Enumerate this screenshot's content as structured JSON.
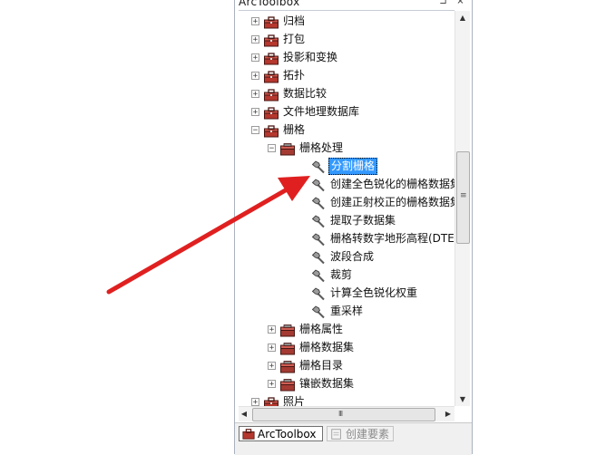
{
  "window": {
    "title": "ArcToolbox",
    "pin_glyph": "⊐",
    "close_glyph": "×"
  },
  "tree": [
    {
      "label": "归档",
      "expander": "+",
      "icon": "toolbox-icon"
    },
    {
      "label": "打包",
      "expander": "+",
      "icon": "toolbox-icon"
    },
    {
      "label": "投影和变换",
      "expander": "+",
      "icon": "toolbox-icon"
    },
    {
      "label": "拓扑",
      "expander": "+",
      "icon": "toolbox-icon"
    },
    {
      "label": "数据比较",
      "expander": "+",
      "icon": "toolbox-icon"
    },
    {
      "label": "文件地理数据库",
      "expander": "+",
      "icon": "toolbox-icon"
    },
    {
      "label": "栅格",
      "expander": "−",
      "icon": "toolbox-icon"
    },
    {
      "label": "栅格处理",
      "expander": "−",
      "icon": "toolset-icon"
    },
    {
      "label": "分割栅格",
      "icon": "hammer-icon",
      "selected": true
    },
    {
      "label": "创建全色锐化的栅格数据集",
      "icon": "hammer-icon"
    },
    {
      "label": "创建正射校正的栅格数据集",
      "icon": "hammer-icon"
    },
    {
      "label": "提取子数据集",
      "icon": "hammer-icon"
    },
    {
      "label": "栅格转数字地形高程(DTED)",
      "icon": "hammer-icon"
    },
    {
      "label": "波段合成",
      "icon": "hammer-icon"
    },
    {
      "label": "裁剪",
      "icon": "hammer-icon"
    },
    {
      "label": "计算全色锐化权重",
      "icon": "hammer-icon"
    },
    {
      "label": "重采样",
      "icon": "hammer-icon"
    },
    {
      "label": "栅格属性",
      "expander": "+",
      "icon": "toolset-icon"
    },
    {
      "label": "栅格数据集",
      "expander": "+",
      "icon": "toolset-icon"
    },
    {
      "label": "栅格目录",
      "expander": "+",
      "icon": "toolset-icon"
    },
    {
      "label": "镶嵌数据集",
      "expander": "+",
      "icon": "toolset-icon"
    },
    {
      "label": "照片",
      "expander": "+",
      "icon": "toolbox-icon"
    }
  ],
  "scroll": {
    "up": "▲",
    "down": "▼",
    "left": "◀",
    "right": "▶",
    "v_grip": "≡",
    "h_grip": "III"
  },
  "tabs": [
    {
      "label": "ArcToolbox",
      "active": true,
      "icon": "toolbox-icon"
    },
    {
      "label": "创建要素",
      "active": false,
      "icon": "create-features-icon"
    }
  ],
  "colors": {
    "selection": "#3399ff",
    "arrow": "#e02020",
    "toolbox_red": "#b5372e"
  }
}
